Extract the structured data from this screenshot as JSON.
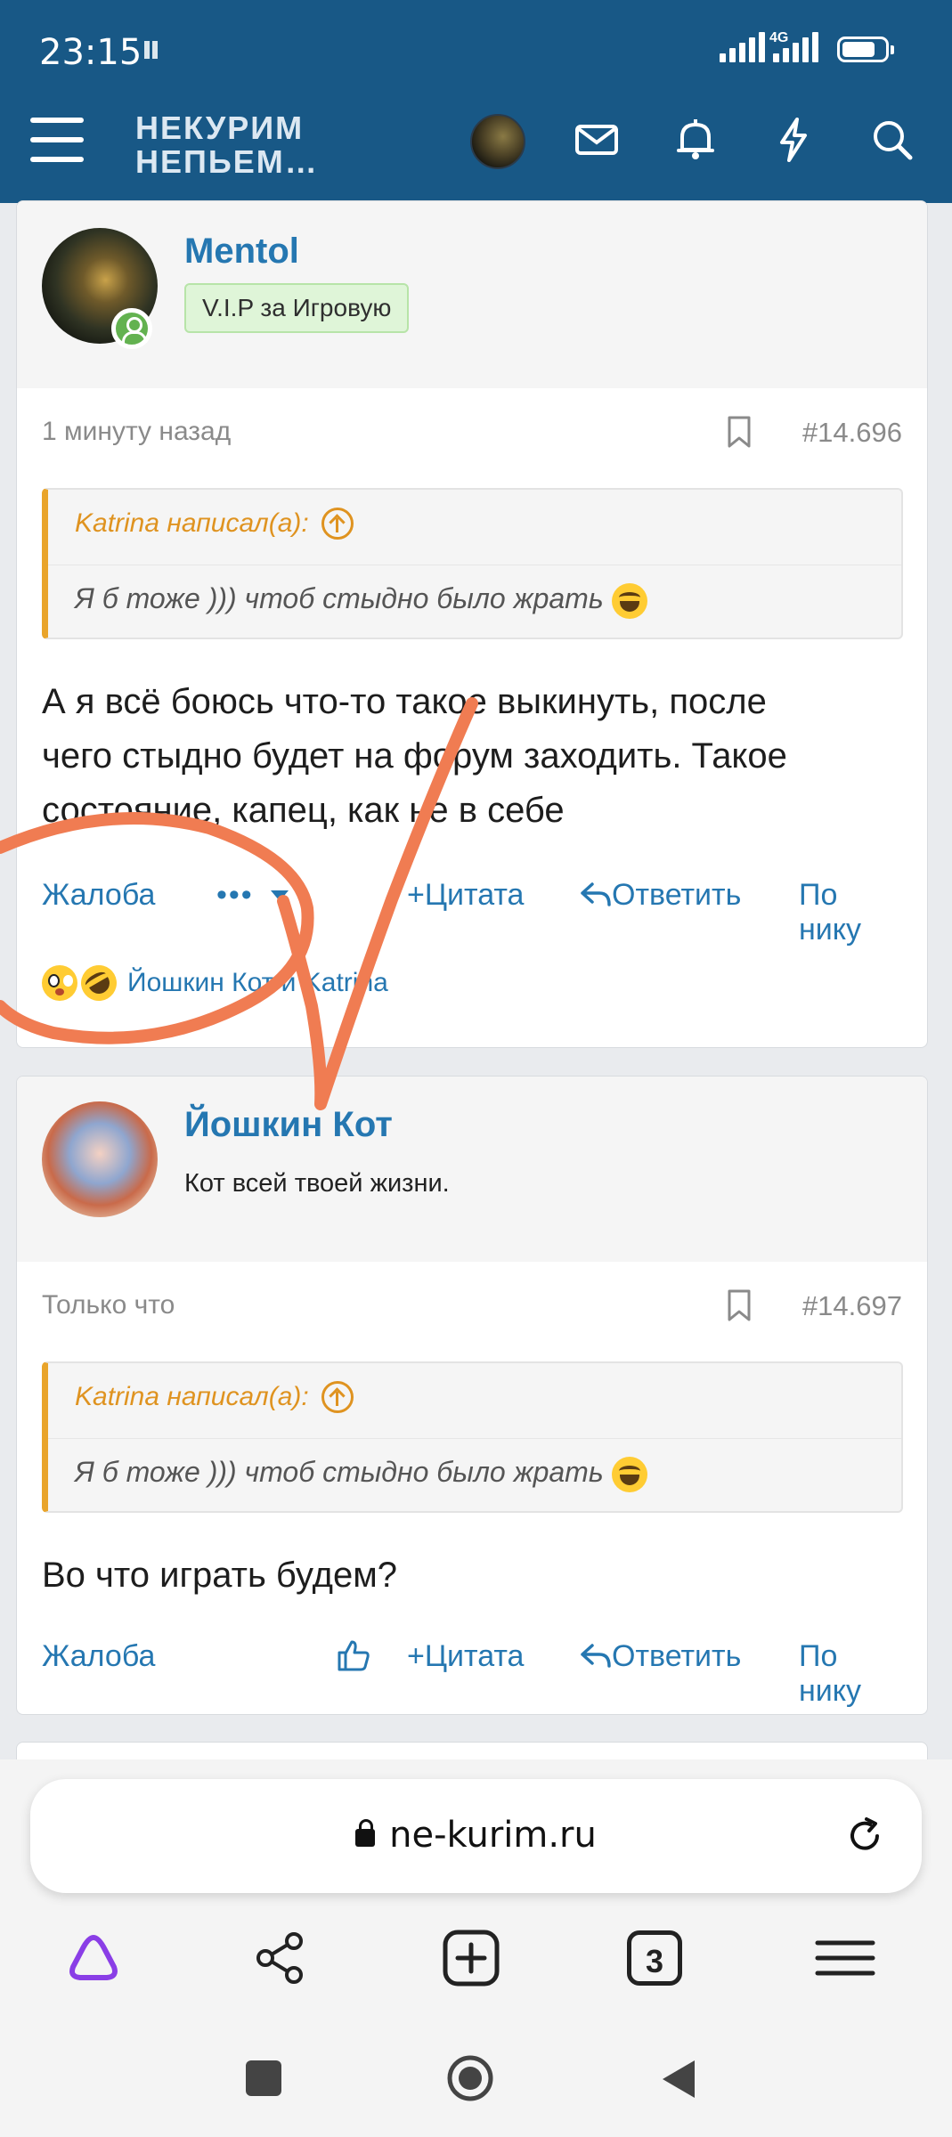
{
  "status_bar": {
    "time": "23:15",
    "network": "4G"
  },
  "header": {
    "logo_line1": "НЕКУРИМ",
    "logo_line2": "НЕПЬЕМ…",
    "icons": [
      "menu-icon",
      "avatar",
      "mail-icon",
      "bell-icon",
      "lightning-icon",
      "search-icon"
    ]
  },
  "posts": [
    {
      "username": "Mentol",
      "badge": "V.I.P за Игровую",
      "time": "1 минуту назад",
      "number": "#14.696",
      "quote_author": "Katrina написал(а):",
      "quote_text": "Я б тоже ))) чтоб стыдно было жрать",
      "message_lines": [
        "А я всё боюсь что-то такое выкинуть, после",
        "чего стыдно будет на форум заходить. Такое",
        "состояние, капец, как не в себе"
      ],
      "actions": {
        "report": "Жалоба",
        "more": "•••",
        "quote": "Цитата",
        "reply": "Ответить",
        "by_nick": "По нику"
      },
      "reactions_text": "Йошкин Кот и Katrina"
    },
    {
      "username": "Йошкин Кот",
      "user_title": "Кот всей твоей жизни.",
      "time": "Только что",
      "number": "#14.697",
      "quote_author": "Katrina написал(а):",
      "quote_text": "Я б тоже ))) чтоб стыдно было жрать",
      "message_lines": [
        "Во что играть будем?"
      ],
      "actions": {
        "report": "Жалоба",
        "quote": "Цитата",
        "reply": "Ответить",
        "by_nick": "По нику"
      }
    }
  ],
  "browser": {
    "url": "ne-kurim.ru",
    "tabs_count": "3"
  },
  "colors": {
    "header_bg": "#185886",
    "link": "#2577b1",
    "quote_accent": "#e9a42a",
    "annotation": "#f07c52"
  }
}
